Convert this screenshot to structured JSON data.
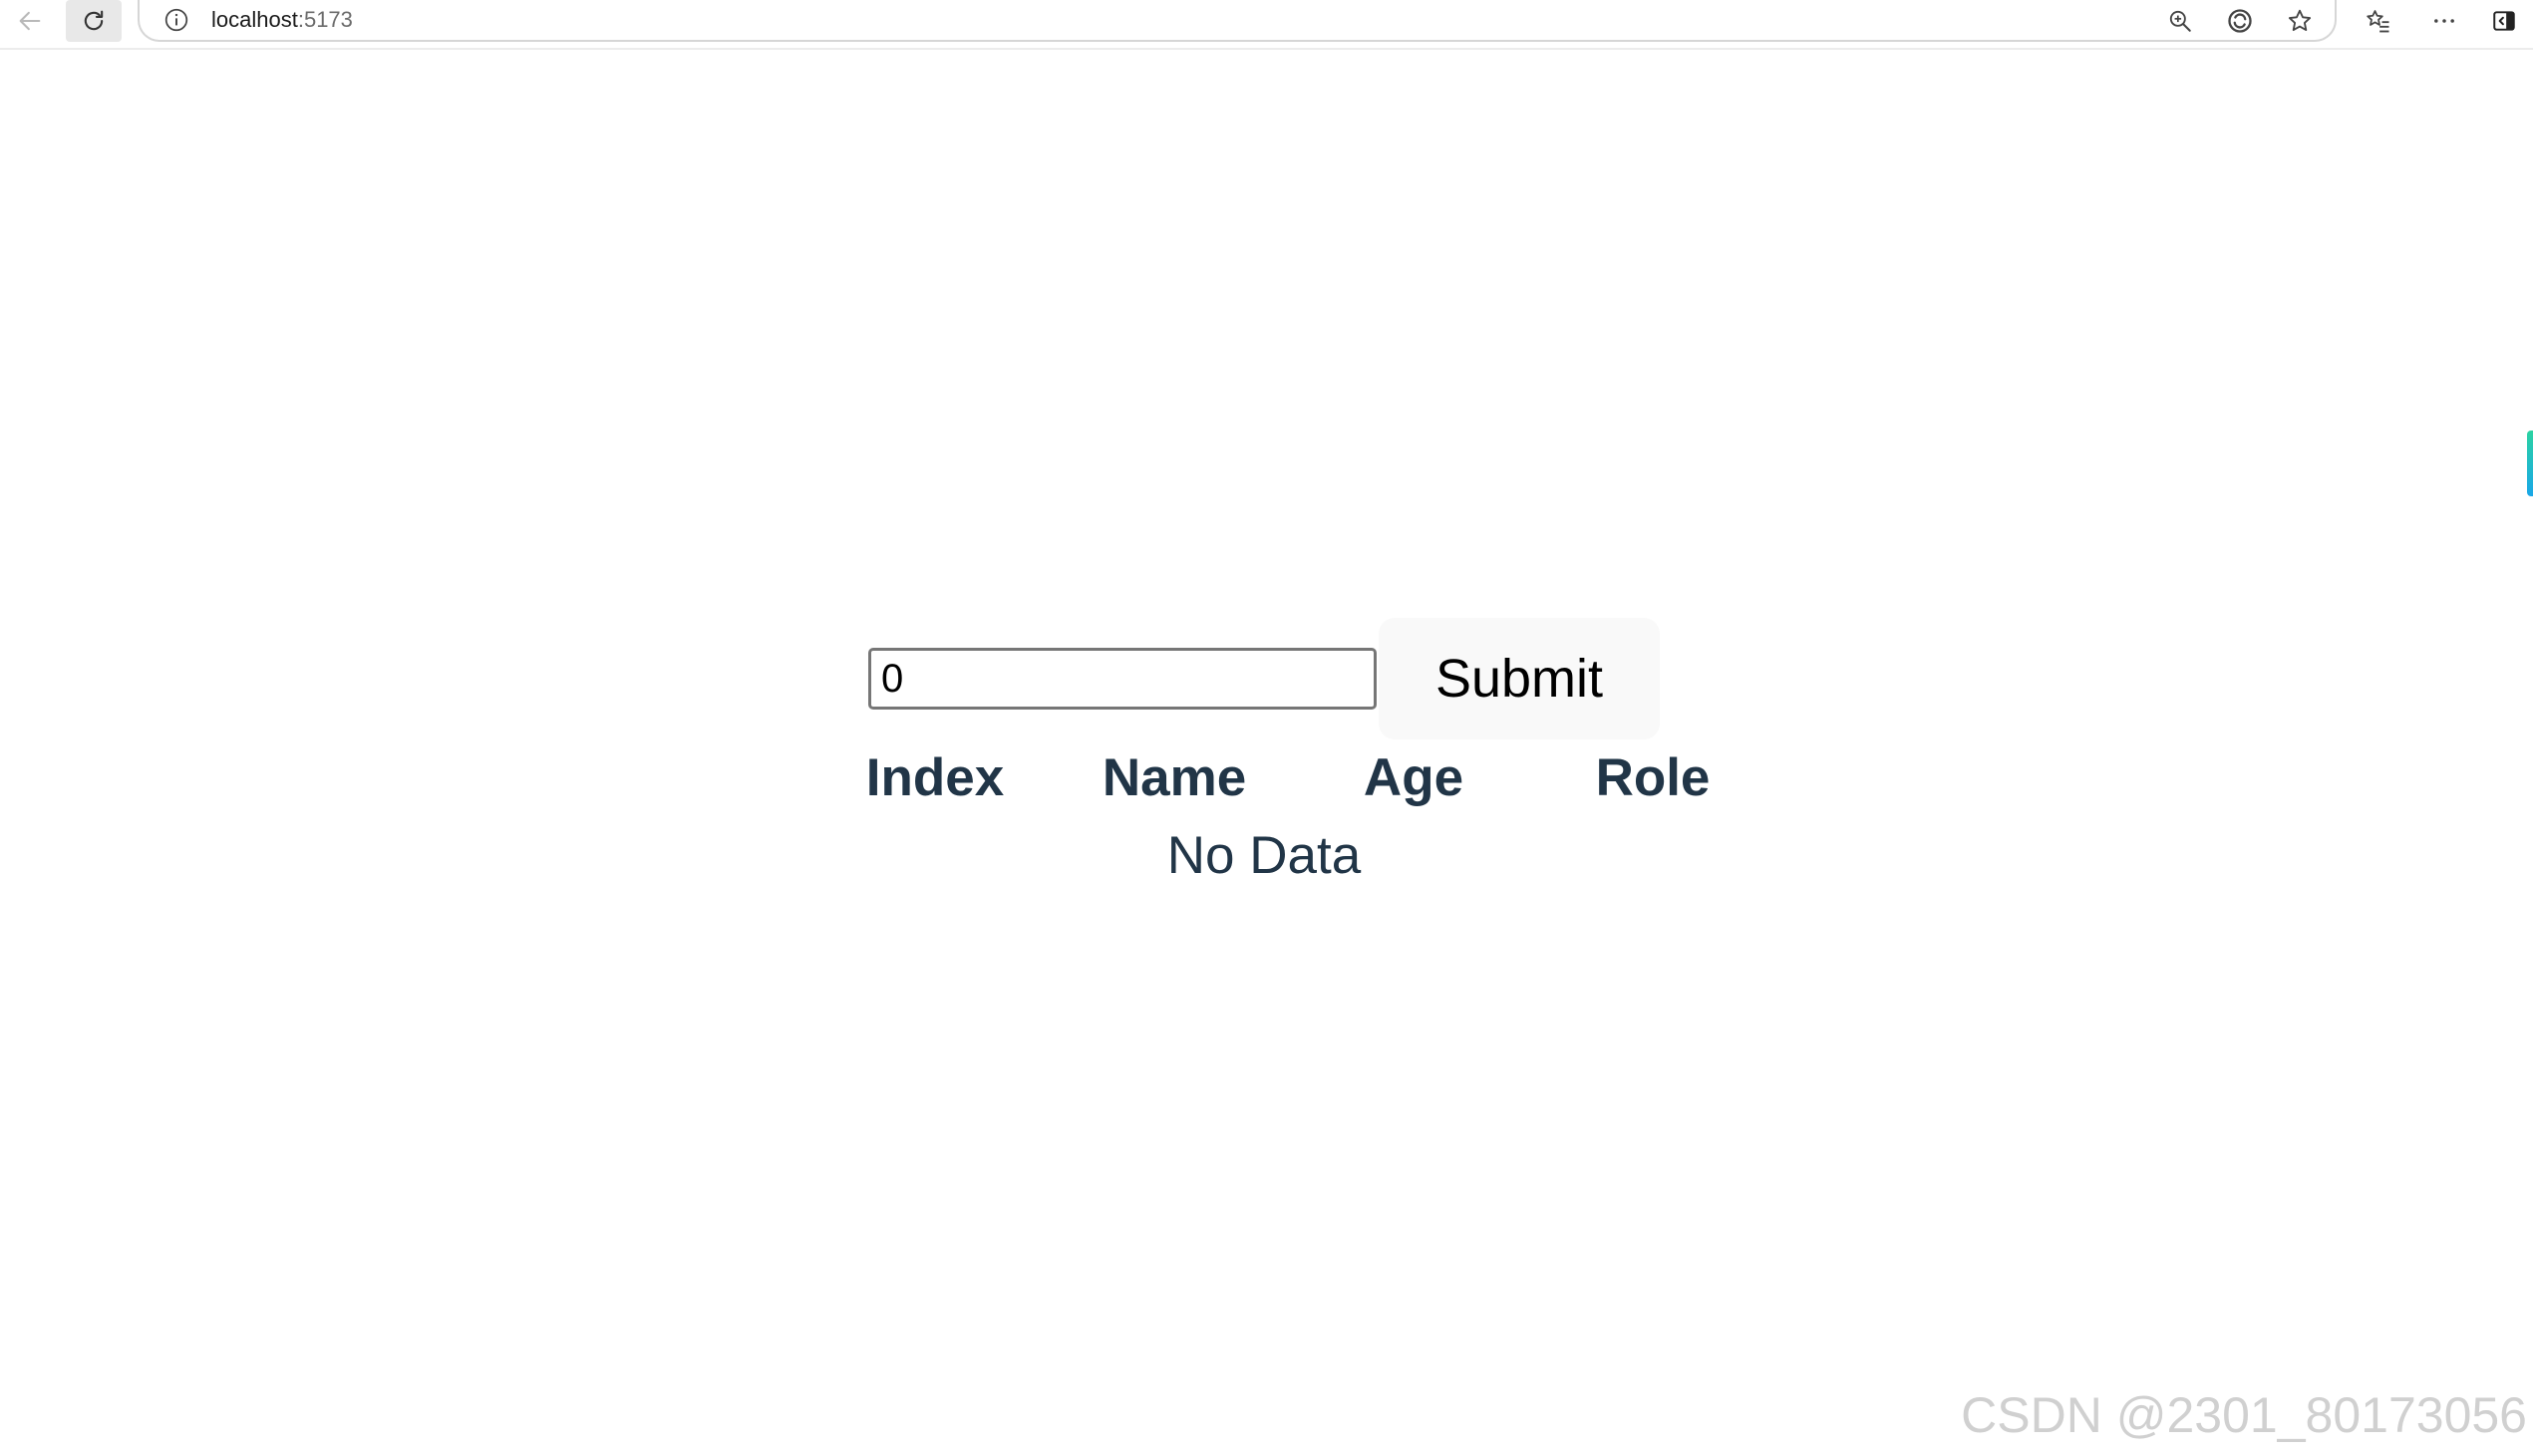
{
  "browser": {
    "url_host": "localhost",
    "url_port": ":5173",
    "icons": {
      "back": "back-arrow-icon",
      "reload": "reload-icon",
      "info": "info-icon",
      "zoom": "zoom-in-icon",
      "edge": "edge-refresh-icon",
      "favorite": "star-icon",
      "favorites_list": "favorites-icon",
      "more": "more-icon",
      "sidebar": "sidebar-icon"
    }
  },
  "form": {
    "input_value": "0",
    "submit_label": "Submit"
  },
  "table": {
    "headers": [
      "Index",
      "Name",
      "Age",
      "Role"
    ],
    "empty_text": "No Data"
  },
  "watermark": "CSDN @2301_80173056",
  "colors": {
    "heading_text": "#213547",
    "button_bg": "#f9f9f9",
    "input_border": "#767676"
  }
}
